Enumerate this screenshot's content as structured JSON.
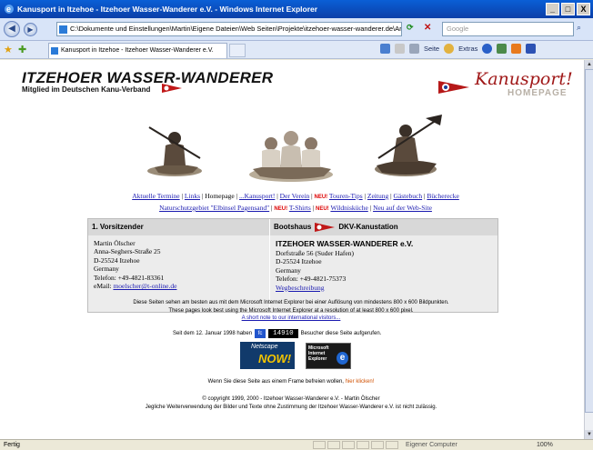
{
  "window": {
    "title": "Kanusport in Itzehoe - Itzehoer Wasser-Wanderer e.V. - Windows Internet Explorer",
    "minimize": "_",
    "maximize": "□",
    "close": "X"
  },
  "address_bar": {
    "url": "C:\\Dokumente und Einstellungen\\Martin\\Eigene Dateien\\Web Seiten\\Projekte\\itzehoer-wasser-wanderer.de\\Ard",
    "search_placeholder": "Google"
  },
  "tabs": [
    {
      "label": "Kanusport in Itzehoe - Itzehoer Wasser-Wanderer e.V."
    }
  ],
  "command_bar": {
    "page": "Seite",
    "extras": "Extras"
  },
  "header": {
    "logo_text": "ITZEHOER WASSER-WANDERER",
    "subtitle": "Mitglied im Deutschen Kanu-Verband",
    "kanusport_text": "Kanusport!",
    "homepage_text": "HOMEPAGE"
  },
  "nav": {
    "row1": [
      {
        "label": "Aktuelle Termine",
        "link": true,
        "new": false
      },
      {
        "label": "Links",
        "link": true,
        "new": false
      },
      {
        "label": "Homepage",
        "link": false,
        "new": false
      },
      {
        "label": "...Kanusport!",
        "link": true,
        "new": false
      },
      {
        "label": "Der Verein",
        "link": true,
        "new": false
      },
      {
        "label": "Touren-Tips",
        "link": true,
        "new": true
      },
      {
        "label": "Zeitung",
        "link": true,
        "new": false
      },
      {
        "label": "Gästebuch",
        "link": true,
        "new": false
      },
      {
        "label": "Bücherecke",
        "link": true,
        "new": false
      }
    ],
    "row2": [
      {
        "label": "Naturschutzgebiet \"Elbinsel Pagensand\"",
        "link": true,
        "new": false
      },
      {
        "label": "T-Shirts",
        "link": true,
        "new": true
      },
      {
        "label": "Wildnisküche",
        "link": true,
        "new": true
      },
      {
        "label": "Neu auf der Web-Site",
        "link": true,
        "new": false
      }
    ],
    "new_badge": "NEU!"
  },
  "contact": {
    "left_header": "1. Vorsitzender",
    "right_header_prefix": "Bootshaus",
    "right_header_suffix": "DKV-Kanustation",
    "left_lines": [
      "Martin Ölscher",
      "Anna-Seghers-Straße 25",
      "D-25524 Itzehoe",
      "Germany",
      "Telefon: +49-4821-83361"
    ],
    "left_email_label": "eMail:",
    "left_email": "moelscher@t-online.de",
    "right_org": "ITZEHOER WASSER-WANDERER e.V.",
    "right_lines": [
      "Dorfstraße 56 (Suder Hafen)",
      "D-25524 Itzehoe",
      "Germany",
      "Telefon: +49-4821-75373"
    ],
    "right_link": "Wegbeschreibung"
  },
  "notice": {
    "de": "Diese Seiten sehen am besten aus mit dem Microsoft Internet Explorer bei einer Auflösung von mindestens 800 x 600 Bildpunkten.",
    "en": "These pages look best using the Microsoft Internet Explorer at a resolution of at least 800 x 600 pixel.",
    "link": "A short note to our international visitors..."
  },
  "counter": {
    "prefix": "Seit dem 12. Januar 1998 haben",
    "value": "14910",
    "suffix": "Besucher diese Seite aufgerufen."
  },
  "badges": {
    "netscape_top": "Netscape",
    "netscape_bottom": "NOW!",
    "ie_text": "Microsoft Internet Explorer",
    "ie_letter": "e"
  },
  "frame_note": {
    "text": "Wenn Sie diese Seite aus einem Frame befreien wollen,",
    "link": "hier klicken!"
  },
  "footer": {
    "line1": "© copyright 1999, 2000 - Itzehoer Wasser-Wanderer e.V. - Martin Ölscher",
    "line2": "Jegliche Weiterverwendung der Bilder und Texte ohne Zustimmung der Itzehoer Wasser-Wanderer e.V. ist nicht zulässig."
  },
  "status_bar": {
    "status": "Fertig",
    "zone": "Eigener Computer",
    "zoom": "100%"
  }
}
